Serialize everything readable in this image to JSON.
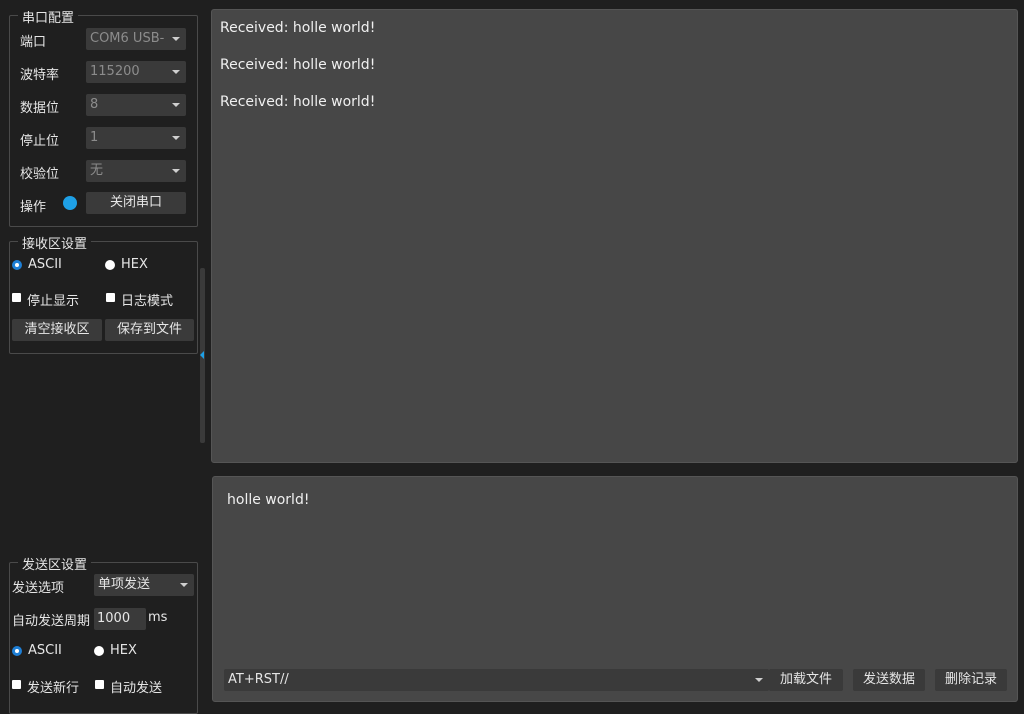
{
  "serial": {
    "title": "串口配置",
    "port_label": "端口",
    "port_value": "COM6 USB-",
    "baud_label": "波特率",
    "baud_value": "115200",
    "databits_label": "数据位",
    "databits_value": "8",
    "stopbits_label": "停止位",
    "stopbits_value": "1",
    "parity_label": "校验位",
    "parity_value": "无",
    "op_label": "操作",
    "close_button": "关闭串口",
    "status_color": "#1ea0e6"
  },
  "receive": {
    "title": "接收区设置",
    "ascii": "ASCII",
    "hex": "HEX",
    "stop_display": "停止显示",
    "log_mode": "日志模式",
    "clear_button": "清空接收区",
    "save_button": "保存到文件",
    "lines": [
      "Received: holle world!",
      "Received: holle world!",
      "Received: holle world!"
    ]
  },
  "send": {
    "title": "发送区设置",
    "option_label": "发送选项",
    "option_value": "单项发送",
    "period_label": "自动发送周期",
    "period_value": "1000",
    "period_unit": "ms",
    "ascii": "ASCII",
    "hex": "HEX",
    "newline": "发送新行",
    "auto_send": "自动发送",
    "text": "holle world!",
    "command_value": "AT+RST//",
    "load_button": "加载文件",
    "send_button": "发送数据",
    "delete_button": "删除记录"
  },
  "colors": {
    "accent": "#1e7fd6",
    "splitter_handle": "#1ea0e6"
  }
}
